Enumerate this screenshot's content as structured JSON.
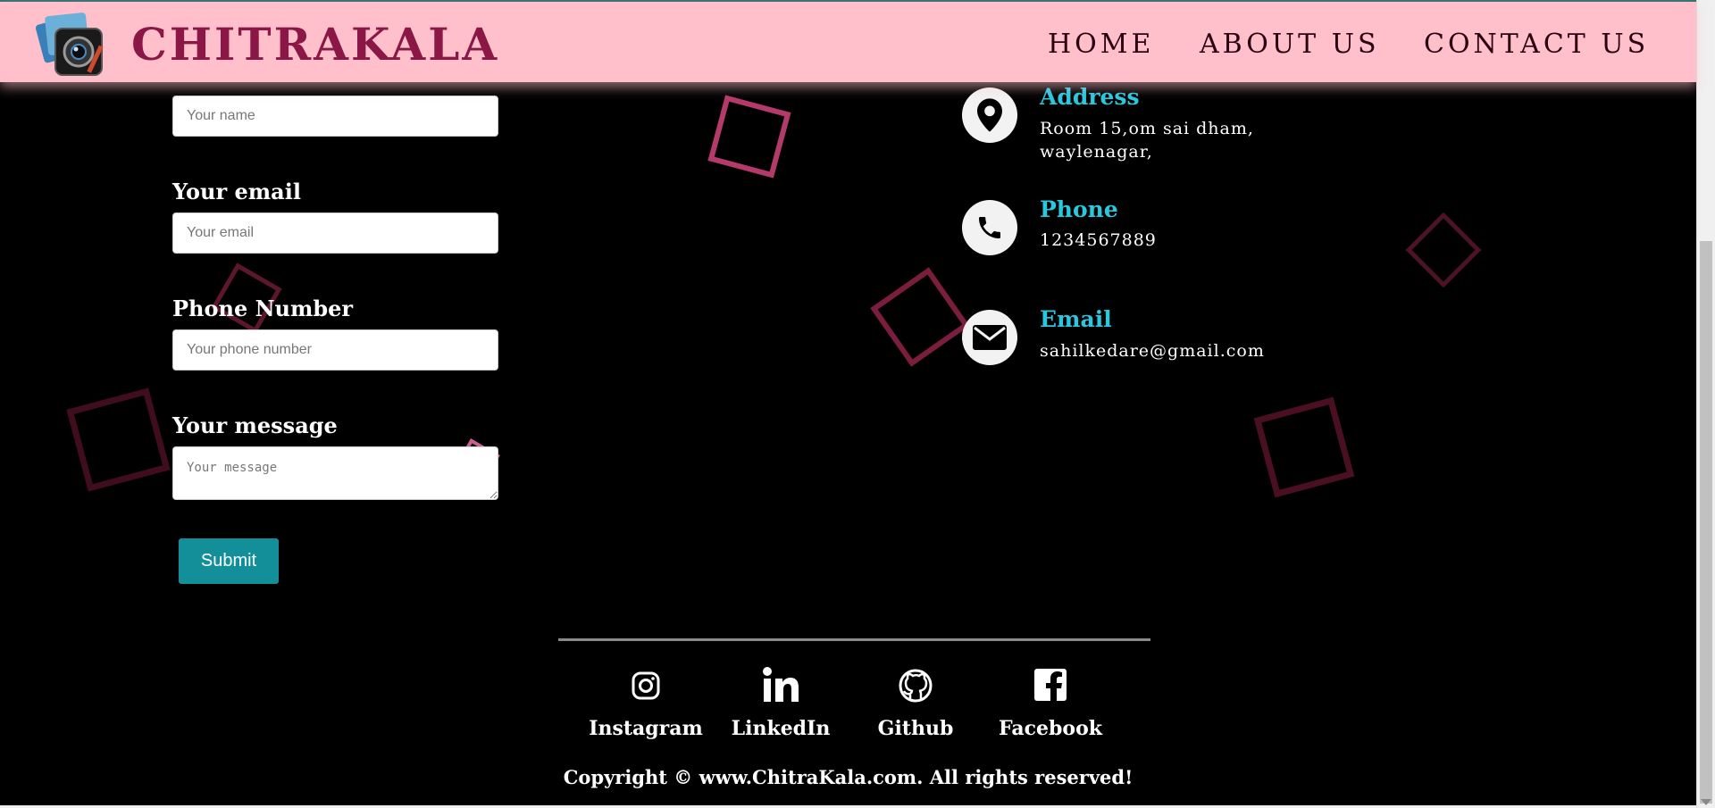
{
  "header": {
    "brand": "CHITRAKALA",
    "nav": [
      "HOME",
      "ABOUT US",
      "CONTACT US"
    ]
  },
  "form": {
    "name_placeholder": "Your name",
    "email_label": "Your email",
    "email_placeholder": "Your email",
    "phone_label": "Phone Number",
    "phone_placeholder": "Your phone number",
    "message_label": "Your message",
    "message_placeholder": "Your message",
    "submit_label": "Submit"
  },
  "contact": {
    "address_title": "Address",
    "address_line1": "Room 15,om sai dham,",
    "address_line2": "waylenagar,",
    "phone_title": "Phone",
    "phone_value": "1234567889",
    "email_title": "Email",
    "email_value": "sahilkedare@gmail.com"
  },
  "footer": {
    "social": [
      "Instagram",
      "LinkedIn",
      "Github",
      "Facebook"
    ],
    "copyright": "Copyright © www.ChitraKala.com. All rights reserved!"
  },
  "colors": {
    "header_bg": "#ffc0cb",
    "brand": "#8b1747",
    "accent": "#29c8de",
    "submit": "#138f99"
  },
  "icons": [
    "camera-logo-icon",
    "location-pin-icon",
    "phone-icon",
    "envelope-icon",
    "instagram-icon",
    "linkedin-icon",
    "github-icon",
    "facebook-icon"
  ]
}
